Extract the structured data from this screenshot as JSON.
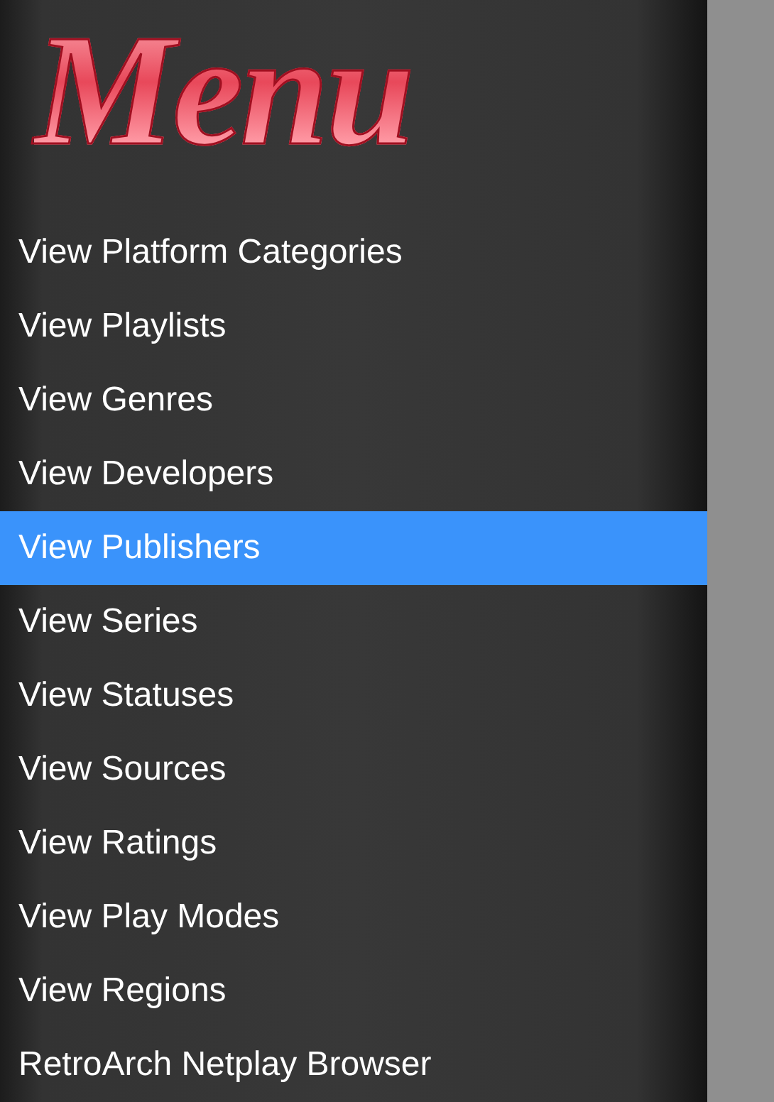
{
  "title": "Menu",
  "items": [
    {
      "label": "View Platform Categories",
      "selected": false
    },
    {
      "label": "View Playlists",
      "selected": false
    },
    {
      "label": "View Genres",
      "selected": false
    },
    {
      "label": "View Developers",
      "selected": false
    },
    {
      "label": "View Publishers",
      "selected": true
    },
    {
      "label": "View Series",
      "selected": false
    },
    {
      "label": "View Statuses",
      "selected": false
    },
    {
      "label": "View Sources",
      "selected": false
    },
    {
      "label": "View Ratings",
      "selected": false
    },
    {
      "label": "View Play Modes",
      "selected": false
    },
    {
      "label": "View Regions",
      "selected": false
    },
    {
      "label": "RetroArch Netplay Browser",
      "selected": false
    }
  ]
}
